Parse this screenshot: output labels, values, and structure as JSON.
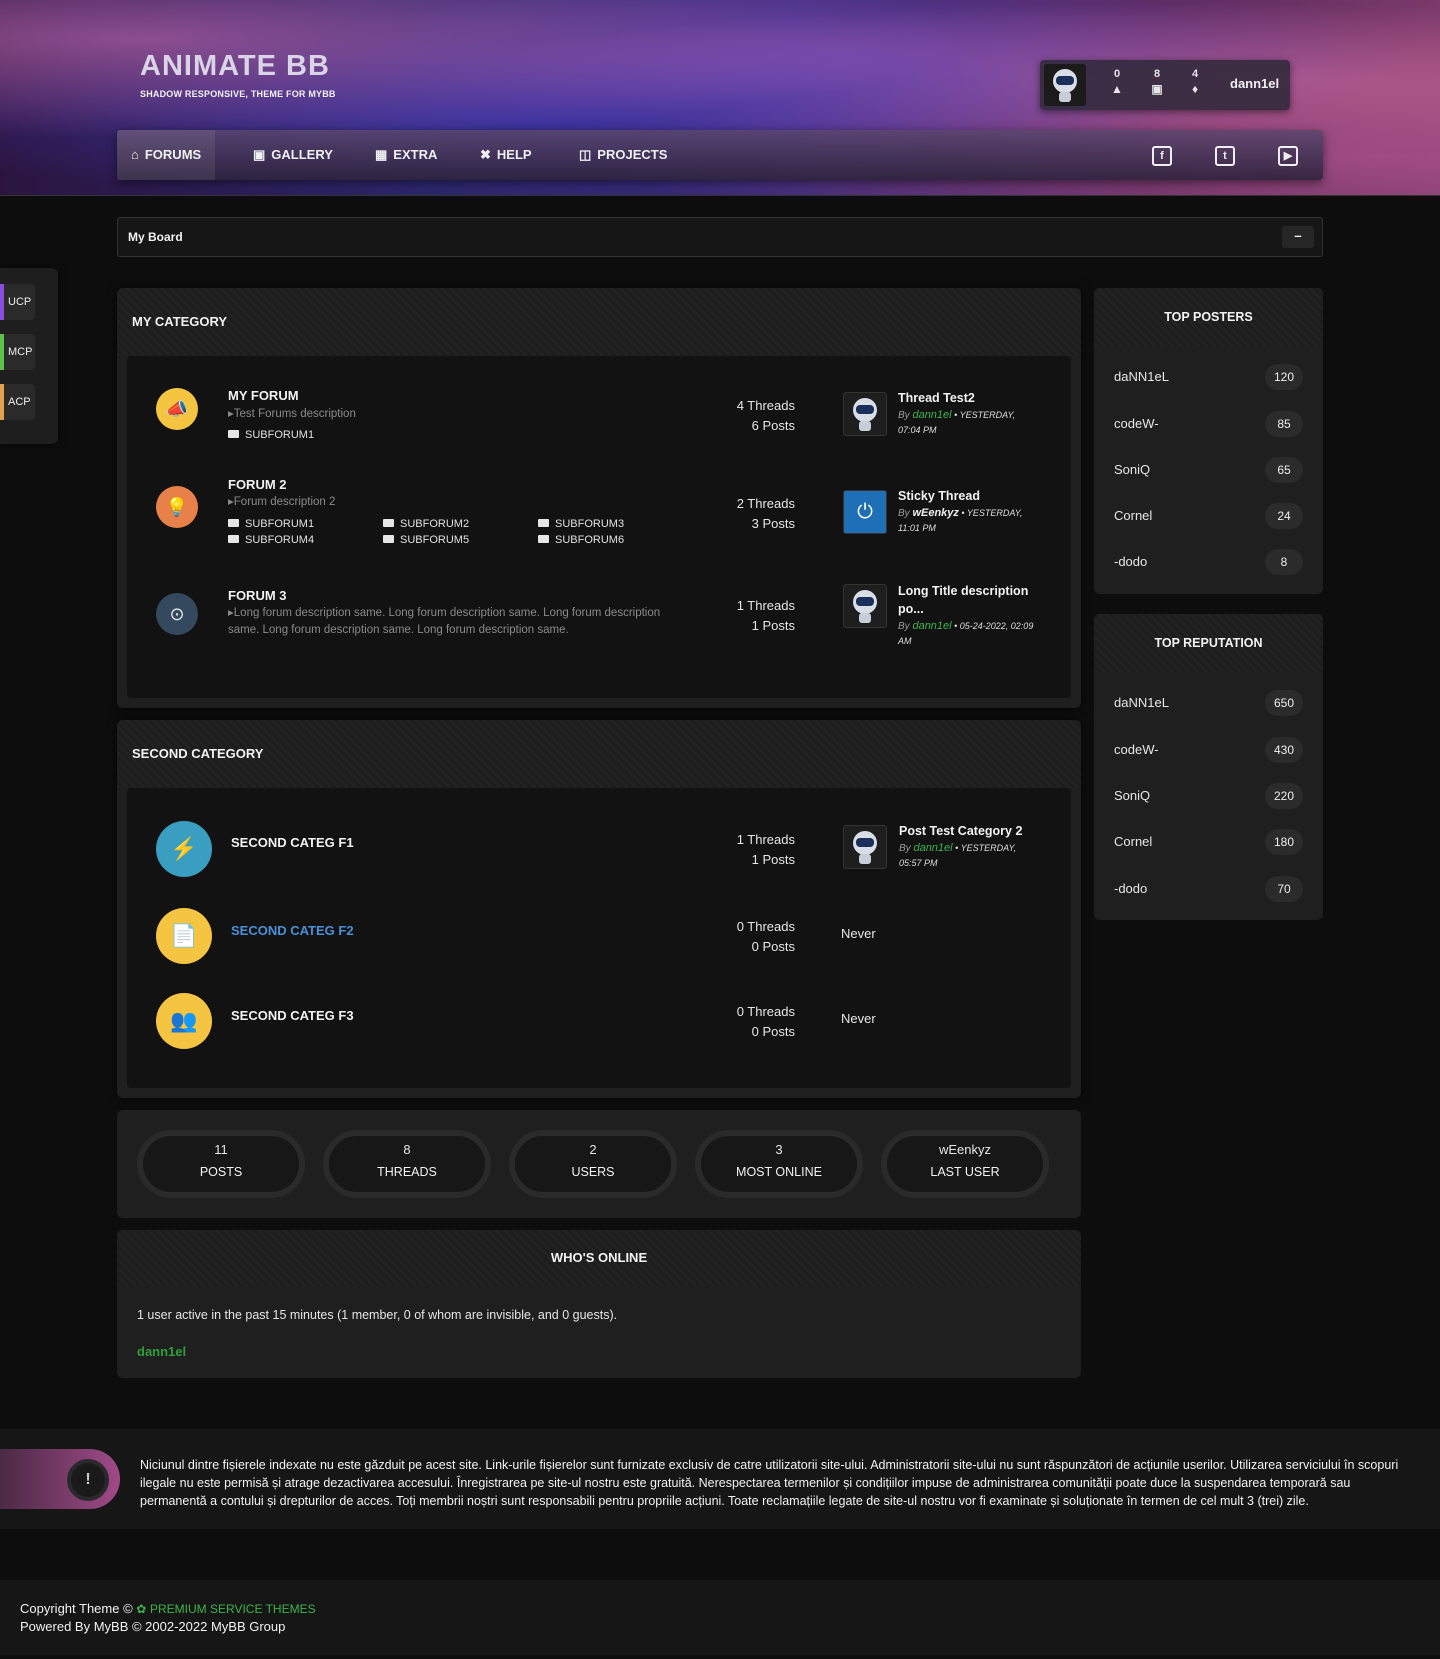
{
  "header": {
    "logo_title": "ANIMATE BB",
    "logo_subtitle": "SHADOW RESPONSIVE, THEME FOR MYBB",
    "user": {
      "messages": "0",
      "threads": "8",
      "notifications": "4",
      "username": "dann1el"
    },
    "nav": [
      {
        "label": "FORUMS",
        "icon": "home-icon"
      },
      {
        "label": "GALLERY",
        "icon": "image-icon"
      },
      {
        "label": "EXTRA",
        "icon": "grid-icon"
      },
      {
        "label": "HELP",
        "icon": "help-icon"
      },
      {
        "label": "PROJECTS",
        "icon": "sitemap-icon"
      }
    ],
    "social": [
      "facebook-icon",
      "twitter-icon",
      "youtube-icon"
    ]
  },
  "breadcrumb": {
    "label": "My Board",
    "toggle": "–"
  },
  "left_panel": [
    "UCP",
    "MCP",
    "ACP"
  ],
  "categories": [
    {
      "title": "MY CATEGORY",
      "forums": [
        {
          "title": "MY FORUM",
          "description": "Test Forums description",
          "subforums": [
            "SUBFORUM1"
          ],
          "threads": "4 Threads",
          "posts": "6 Posts",
          "last_post": {
            "title": "Thread Test2",
            "by": "By",
            "user": "dann1el",
            "date": " • YESTERDAY, 07:04 PM"
          }
        },
        {
          "title": "FORUM 2",
          "description": "Forum description 2",
          "subforums": [
            "SUBFORUM1",
            "SUBFORUM2",
            "SUBFORUM3",
            "SUBFORUM4",
            "SUBFORUM5",
            "SUBFORUM6"
          ],
          "threads": "2 Threads",
          "posts": "3 Posts",
          "last_post": {
            "title": "Sticky Thread",
            "by": "By",
            "user": "wEenkyz",
            "date": " • YESTERDAY, 11:01 PM"
          }
        },
        {
          "title": "FORUM 3",
          "description": "Long forum description same. Long forum description same. Long forum description same. Long forum description same. Long forum description same.",
          "threads": "1 Threads",
          "posts": "1 Posts",
          "last_post": {
            "title": "Long Title description po...",
            "by": "By",
            "user": "dann1el",
            "date": " • 05-24-2022, 02:09 AM"
          }
        }
      ]
    },
    {
      "title": "SECOND CATEGORY",
      "forums": [
        {
          "title": "SECOND CATEG F1",
          "threads": "1 Threads",
          "posts": "1 Posts",
          "last_post": {
            "title": "Post Test Category 2",
            "by": "By",
            "user": "dann1el",
            "date": " • YESTERDAY, 05:57 PM"
          }
        },
        {
          "title": "SECOND CATEG F2",
          "threads": "0 Threads",
          "posts": "0 Posts",
          "never": "Never"
        },
        {
          "title": "SECOND CATEG F3",
          "threads": "0 Threads",
          "posts": "0 Posts",
          "never": "Never"
        }
      ]
    }
  ],
  "stats": [
    {
      "value": "11",
      "label": "POSTS"
    },
    {
      "value": "8",
      "label": "THREADS"
    },
    {
      "value": "2",
      "label": "USERS"
    },
    {
      "value": "3",
      "label": "MOST ONLINE"
    },
    {
      "value": "wEenkyz",
      "label": "LAST USER"
    }
  ],
  "whos_online": {
    "title": "WHO'S ONLINE",
    "text": "1 user active in the past 15 minutes (1 member, 0 of whom are invisible, and 0 guests).",
    "user": "dann1el"
  },
  "top_posters": {
    "title": "TOP POSTERS",
    "rows": [
      {
        "name": "daNN1eL",
        "count": "120"
      },
      {
        "name": "codeW-",
        "count": "85"
      },
      {
        "name": "SoniQ",
        "count": "65"
      },
      {
        "name": "Cornel",
        "count": "24"
      },
      {
        "name": "-dodo",
        "count": "8"
      }
    ]
  },
  "top_reputation": {
    "title": "TOP REPUTATION",
    "rows": [
      {
        "name": "daNN1eL",
        "count": "650"
      },
      {
        "name": "codeW-",
        "count": "430"
      },
      {
        "name": "SoniQ",
        "count": "220"
      },
      {
        "name": "Cornel",
        "count": "180"
      },
      {
        "name": "-dodo",
        "count": "70"
      }
    ]
  },
  "disclaimer": "Niciunul dintre fișierele indexate nu este găzduit pe acest site. Link-urile fișierelor sunt furnizate exclusiv de catre utilizatorii site-ului. Administratorii site-ului nu sunt răspunzători de acțiunile userilor. Utilizarea serviciului în scopuri ilegale nu este permisă și atrage dezactivarea accesului. Înregistrarea pe site-ul nostru este gratuită. Nerespectarea termenilor și condițiilor impuse de administrarea comunității poate duce la suspendarea temporară sau permanentă a contului și drepturilor de acces. Toți membrii noștri sunt responsabili pentru propriile acțiuni. Toate reclamațiile legate de site-ul nostru vor fi examinate și soluționate în termen de cel mult 3 (trei) zile.",
  "footer": {
    "copyright": "Copyright Theme ©",
    "brand": "PREMIUM SERVICE THEMES",
    "powered": "Powered By MyBB © 2002-2022 MyBB Group"
  },
  "colors": {
    "accent_green": "#3bb54a",
    "link_blue": "#4a90d9"
  }
}
